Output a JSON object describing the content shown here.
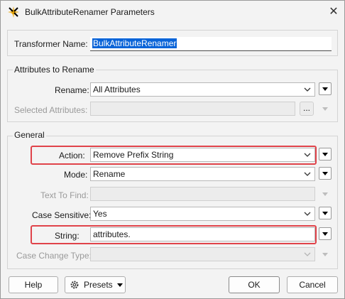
{
  "window": {
    "title": "BulkAttributeRenamer Parameters",
    "close_glyph": "✕"
  },
  "transformer": {
    "label": "Transformer Name:",
    "value": "BulkAttributeRenamer"
  },
  "attributes_group": {
    "title": "Attributes to Rename",
    "rename_label": "Rename:",
    "rename_value": "All Attributes",
    "selected_label": "Selected Attributes:",
    "selected_value": "",
    "browse_label": "..."
  },
  "general_group": {
    "title": "General",
    "action_label": "Action:",
    "action_value": "Remove Prefix String",
    "mode_label": "Mode:",
    "mode_value": "Rename",
    "text_to_find_label": "Text To Find:",
    "text_to_find_value": "",
    "case_sensitive_label": "Case Sensitive:",
    "case_sensitive_value": "Yes",
    "string_label": "String:",
    "string_value": "attributes.",
    "case_change_label": "Case Change Type:",
    "case_change_value": ""
  },
  "footer": {
    "help_label": "Help",
    "presets_label": "Presets",
    "ok_label": "OK",
    "cancel_label": "Cancel"
  },
  "colors": {
    "highlight": "#e0434a",
    "selection": "#0a64d8"
  }
}
